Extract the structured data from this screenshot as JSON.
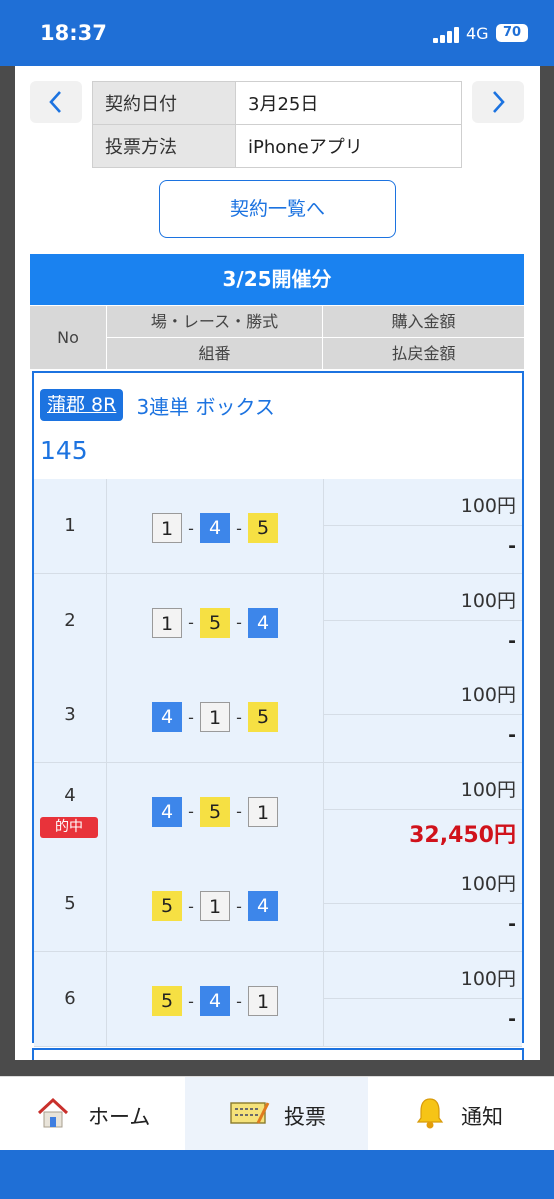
{
  "status": {
    "time": "18:37",
    "network": "4G",
    "battery": "70"
  },
  "contract": {
    "rows": [
      {
        "label": "契約日付",
        "value": "3月25日"
      },
      {
        "label": "投票方法",
        "value": "iPhoneアプリ"
      }
    ],
    "list_button": "契約一覧へ"
  },
  "section_title": "3/25開催分",
  "columns": {
    "no": "No",
    "race": "場・レース・勝式",
    "combo": "組番",
    "buy": "購入金額",
    "payout": "払戻金額"
  },
  "race": {
    "venue": "蒲郡 8R",
    "bet_type": "3連単 ボックス",
    "numbers": "145"
  },
  "rows": [
    {
      "no": "1",
      "combo": [
        "1",
        "4",
        "5"
      ],
      "buy": "100円",
      "payout": "-",
      "hit": ""
    },
    {
      "no": "2",
      "combo": [
        "1",
        "5",
        "4"
      ],
      "buy": "100円",
      "payout": "-",
      "hit": ""
    },
    {
      "no": "3",
      "combo": [
        "4",
        "1",
        "5"
      ],
      "buy": "100円",
      "payout": "-",
      "hit": ""
    },
    {
      "no": "4",
      "combo": [
        "4",
        "5",
        "1"
      ],
      "buy": "100円",
      "payout": "32,450円",
      "hit": "的中"
    },
    {
      "no": "5",
      "combo": [
        "5",
        "1",
        "4"
      ],
      "buy": "100円",
      "payout": "-",
      "hit": ""
    },
    {
      "no": "6",
      "combo": [
        "5",
        "4",
        "1"
      ],
      "buy": "100円",
      "payout": "-",
      "hit": ""
    }
  ],
  "tabs": [
    {
      "label": "ホーム",
      "icon": "home-icon"
    },
    {
      "label": "投票",
      "icon": "ticket-icon"
    },
    {
      "label": "通知",
      "icon": "bell-icon"
    }
  ],
  "colors": {
    "accent": "#1c73e0",
    "header": "#1a82f0",
    "hit": "#e8333a",
    "win_text": "#d0121b"
  }
}
